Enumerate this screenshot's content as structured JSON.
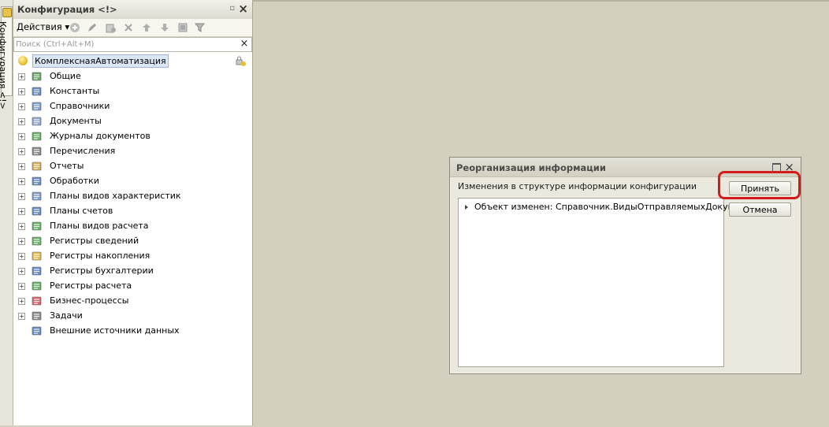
{
  "sidebar_tab": {
    "label": "Конфигурация <!>"
  },
  "config_panel": {
    "title": "Конфигурация <!>",
    "toolbar": {
      "actions_label": "Действия ▾"
    },
    "search": {
      "placeholder": "Поиск (Ctrl+Alt+M)",
      "value": ""
    },
    "root": {
      "label": "КомплекснаяАвтоматизация"
    },
    "items": [
      {
        "label": "Общие",
        "icon": "common-icon",
        "color": "#3a8a3a"
      },
      {
        "label": "Константы",
        "icon": "constants-icon",
        "color": "#3a6ab0"
      },
      {
        "label": "Справочники",
        "icon": "catalogs-icon",
        "color": "#5a7fb8"
      },
      {
        "label": "Документы",
        "icon": "documents-icon",
        "color": "#6f8fbf"
      },
      {
        "label": "Журналы документов",
        "icon": "document-journals-icon",
        "color": "#3c9a3c"
      },
      {
        "label": "Перечисления",
        "icon": "enums-icon",
        "color": "#666666"
      },
      {
        "label": "Отчеты",
        "icon": "reports-icon",
        "color": "#c89a2a"
      },
      {
        "label": "Обработки",
        "icon": "processing-icon",
        "color": "#3a6ab0"
      },
      {
        "label": "Планы видов характеристик",
        "icon": "characteristic-types-icon",
        "color": "#5a7fb8"
      },
      {
        "label": "Планы счетов",
        "icon": "chart-of-accounts-icon",
        "color": "#3a6ab0"
      },
      {
        "label": "Планы видов расчета",
        "icon": "calculation-types-icon",
        "color": "#3c9a3c"
      },
      {
        "label": "Регистры сведений",
        "icon": "info-registers-icon",
        "color": "#3c9a3c"
      },
      {
        "label": "Регистры накопления",
        "icon": "accumulation-registers-icon",
        "color": "#d9a520"
      },
      {
        "label": "Регистры бухгалтерии",
        "icon": "accounting-registers-icon",
        "color": "#3a6ab0"
      },
      {
        "label": "Регистры расчета",
        "icon": "calculation-registers-icon",
        "color": "#3c9a3c"
      },
      {
        "label": "Бизнес-процессы",
        "icon": "business-processes-icon",
        "color": "#c83a3a"
      },
      {
        "label": "Задачи",
        "icon": "tasks-icon",
        "color": "#666666"
      },
      {
        "label": "Внешние источники данных",
        "icon": "external-data-sources-icon",
        "color": "#3a6ab0",
        "no_expander": true
      }
    ]
  },
  "dialog": {
    "title": "Реорганизация информации",
    "description": "Изменения в структуре информации конфигурации",
    "list_items": [
      {
        "text": "Объект изменен: Справочник.ВидыОтправляемыхДокуме..."
      }
    ],
    "accept_label": "Принять",
    "cancel_label": "Отмена"
  },
  "colors": {
    "highlight": "#d41b1b",
    "workspace": "#d4d0c0"
  }
}
